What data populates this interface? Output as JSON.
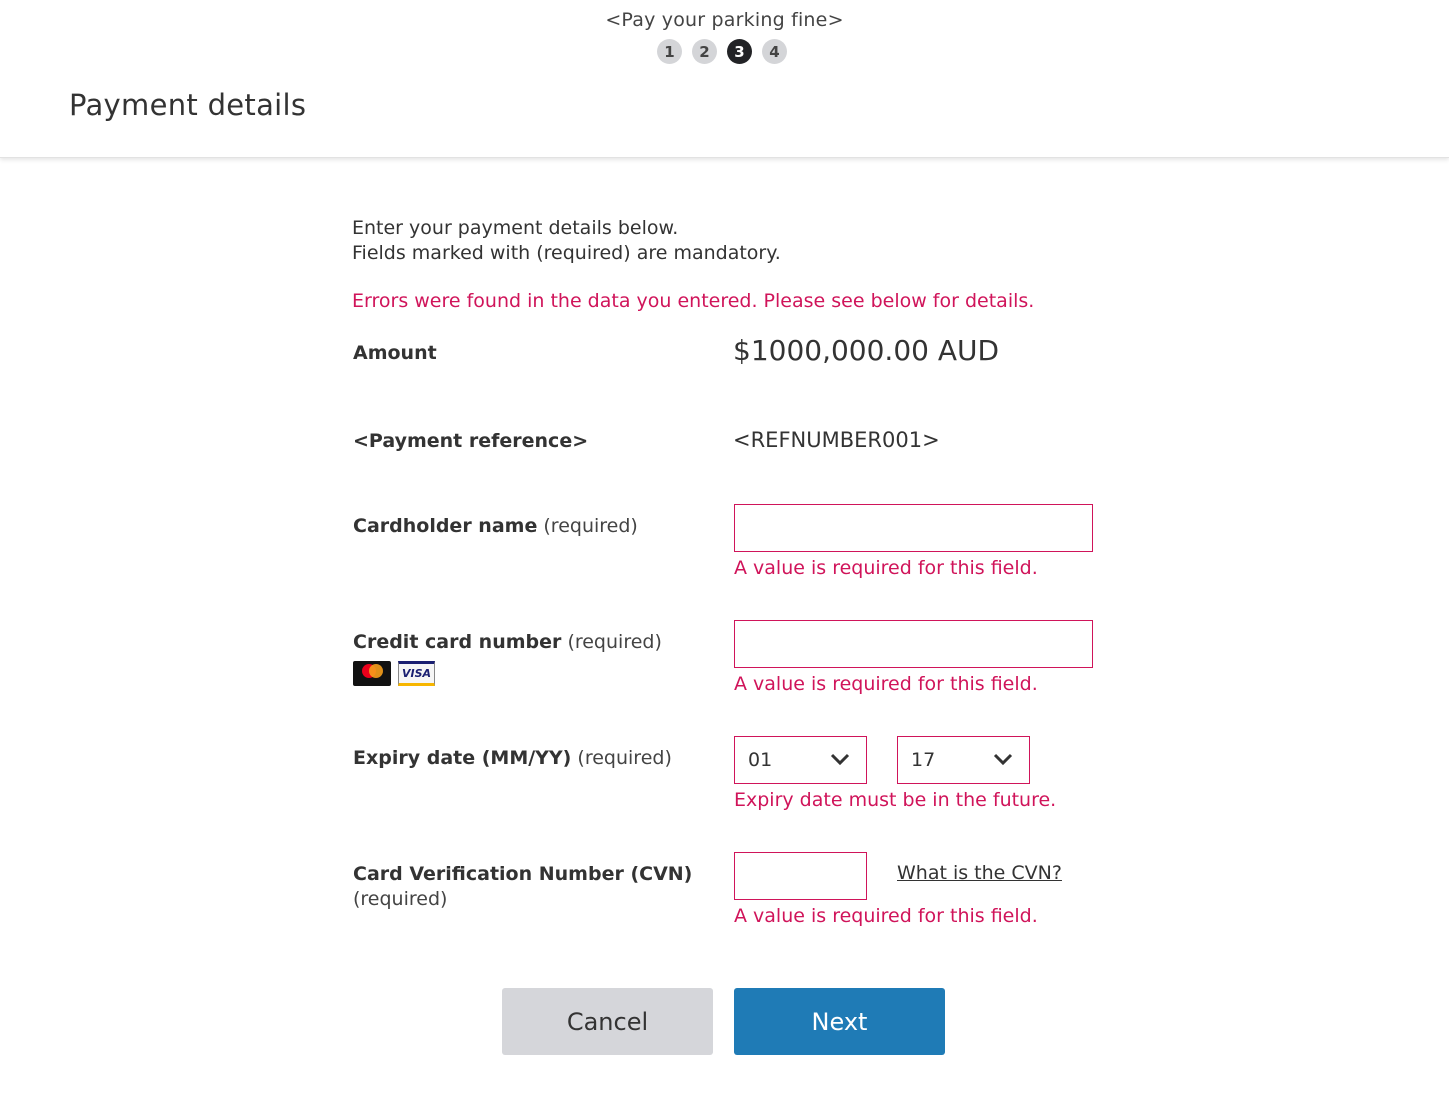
{
  "header": {
    "service_title": "<Pay your parking fine>",
    "steps": [
      "1",
      "2",
      "3",
      "4"
    ],
    "active_step": "3",
    "page_title": "Payment details"
  },
  "intro": {
    "line1": "Enter your payment details below.",
    "line2": "Fields marked with (required) are mandatory."
  },
  "error_summary": "Errors were found in the data you entered. Please see below for details.",
  "required_marker": "(required)",
  "amount": {
    "label": "Amount",
    "value": "$1000,000.00 AUD"
  },
  "reference": {
    "label": "<Payment reference>",
    "value": "<REFNUMBER001>"
  },
  "cardholder": {
    "label": "Cardholder name",
    "value": "",
    "error": "A value is required for this field."
  },
  "card_number": {
    "label": "Credit card number",
    "value": "",
    "error": "A value is required for this field.",
    "logos": [
      {
        "name": "mastercard",
        "text": "mastercard"
      },
      {
        "name": "visa",
        "text": "VISA"
      }
    ]
  },
  "expiry": {
    "label": "Expiry date (MM/YY)",
    "month": "01",
    "year": "17",
    "error": "Expiry date must be in the future."
  },
  "cvn": {
    "label": "Card Verification Number (CVN)",
    "value": "",
    "help_link": "What is the CVN?",
    "error": "A value is required for this field."
  },
  "actions": {
    "cancel": "Cancel",
    "next": "Next"
  },
  "colors": {
    "error": "#d0145a",
    "primary": "#1f7bb6",
    "secondary": "#d5d6da",
    "active_step": "#222326"
  }
}
